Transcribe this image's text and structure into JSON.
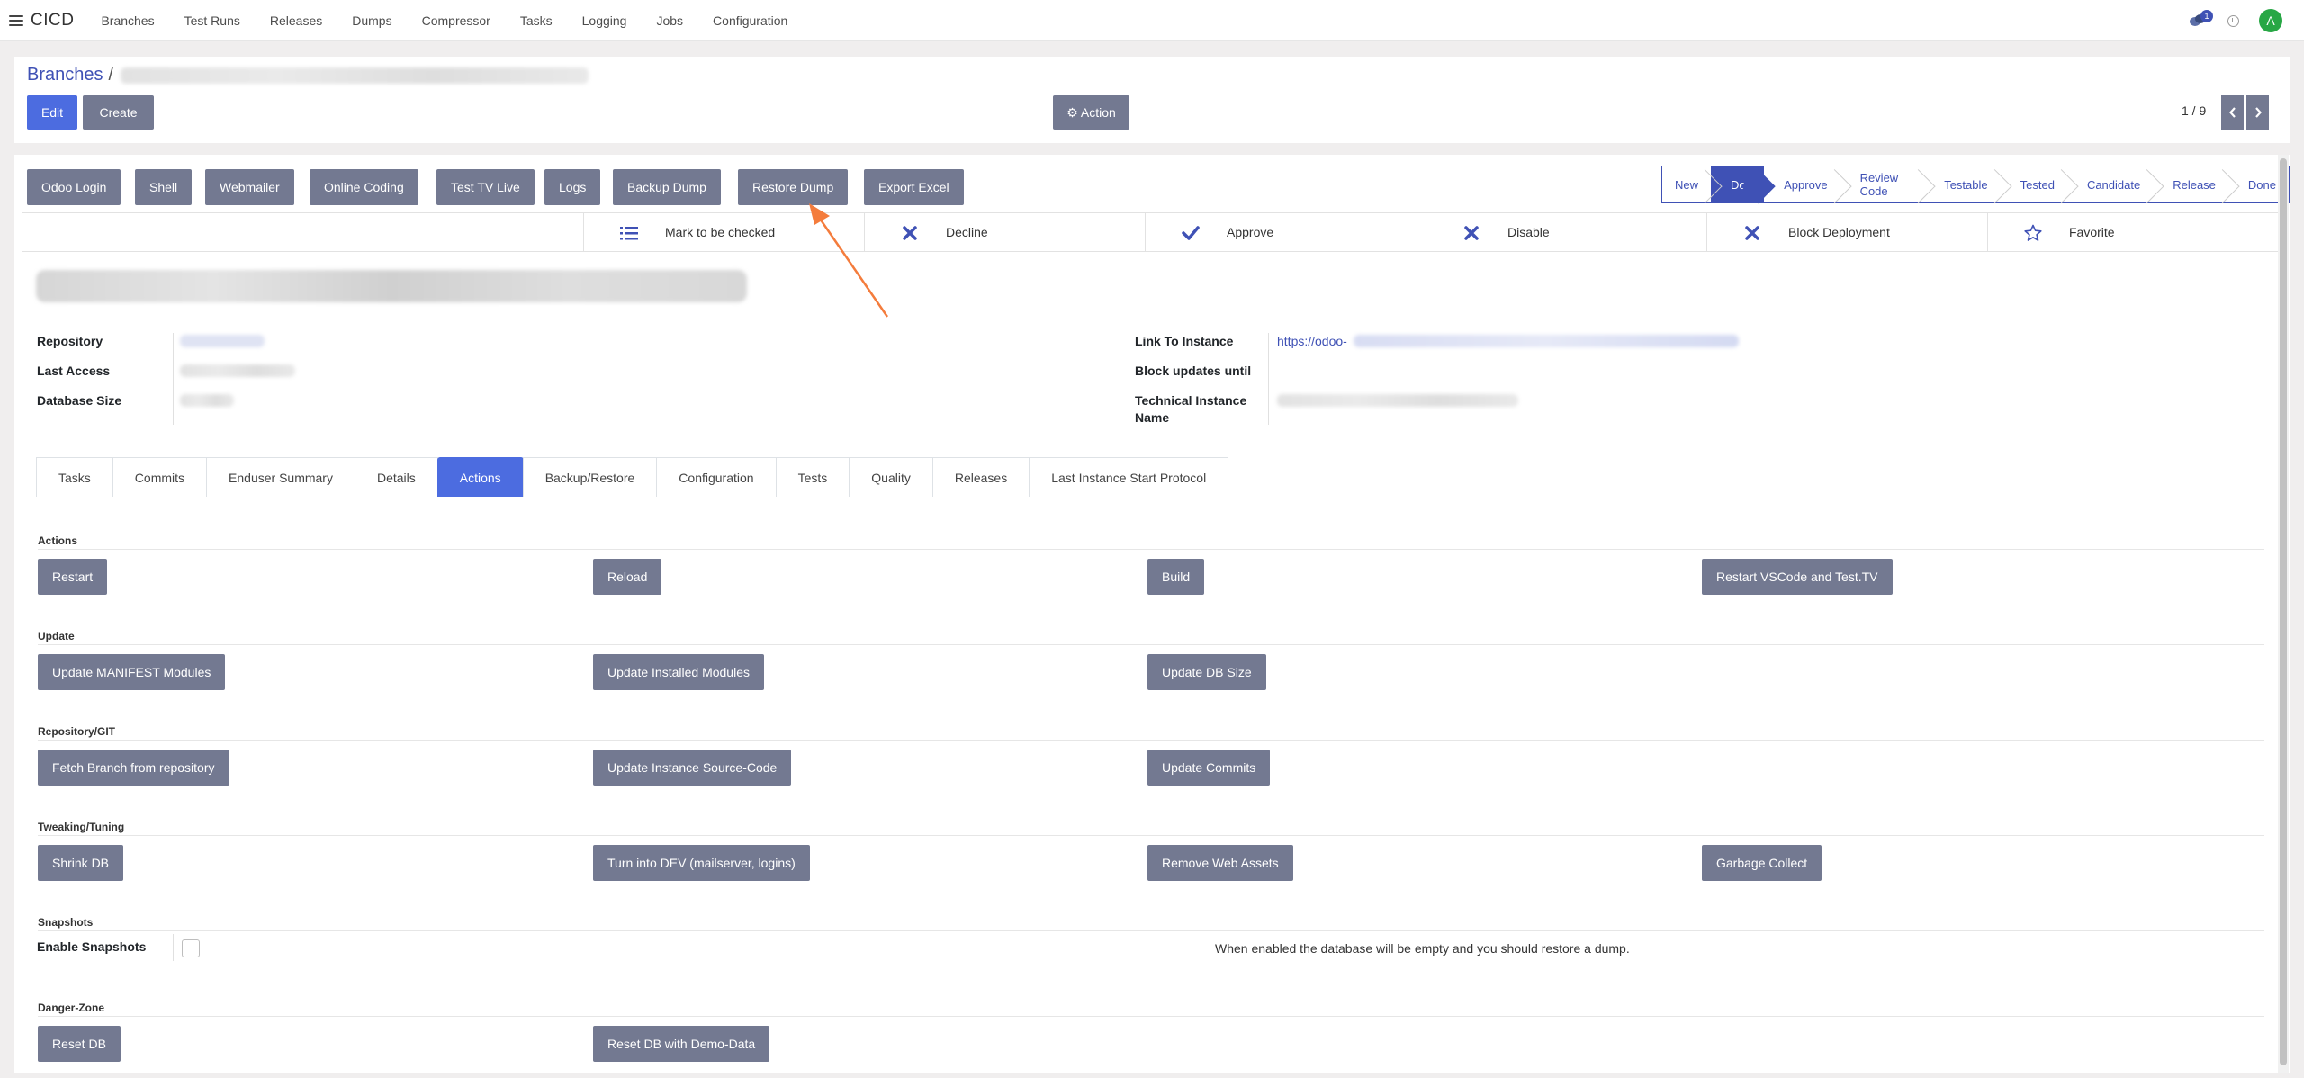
{
  "topnav": {
    "brand": "CICD",
    "menu": [
      "Branches",
      "Test Runs",
      "Releases",
      "Dumps",
      "Compressor",
      "Tasks",
      "Logging",
      "Jobs",
      "Configuration"
    ],
    "message_count": "1",
    "avatar_letter": "A"
  },
  "control_panel": {
    "breadcrumb_root": "Branches",
    "breadcrumb_sep": "/",
    "edit_label": "Edit",
    "create_label": "Create",
    "action_label": "⚙ Action",
    "pager": "1 / 9"
  },
  "header_buttons": [
    "Odoo Login",
    "Shell",
    "Webmailer",
    "Online Coding",
    "Test TV Live",
    "Logs",
    "Backup Dump",
    "Restore Dump",
    "Export Excel"
  ],
  "statusbar": {
    "stages": [
      "New",
      "Dev",
      "Approve",
      "Review Code",
      "Testable",
      "Tested",
      "Candidate",
      "Release",
      "Done"
    ],
    "active": "Dev"
  },
  "smart_buttons": [
    {
      "label": "Mark to be checked",
      "icon": "list-icon"
    },
    {
      "label": "Decline",
      "icon": "x-icon"
    },
    {
      "label": "Approve",
      "icon": "check-icon"
    },
    {
      "label": "Disable",
      "icon": "x-icon"
    },
    {
      "label": "Block Deployment",
      "icon": "x-icon"
    },
    {
      "label": "Favorite",
      "icon": "star-icon"
    }
  ],
  "fields_left": {
    "repository": "Repository",
    "last_access": "Last Access",
    "database_size": "Database Size"
  },
  "fields_right": {
    "link_to_instance": "Link To Instance",
    "link_value": "https://odoo-",
    "block_updates_until": "Block updates until",
    "technical_instance_name_1": "Technical Instance",
    "technical_instance_name_2": "Name"
  },
  "tabs": [
    "Tasks",
    "Commits",
    "Enduser Summary",
    "Details",
    "Actions",
    "Backup/Restore",
    "Configuration",
    "Tests",
    "Quality",
    "Releases",
    "Last Instance Start Protocol"
  ],
  "active_tab": "Actions",
  "sections": {
    "actions": {
      "title": "Actions",
      "buttons": [
        "Restart",
        "Reload",
        "Build",
        "Restart VSCode and Test.TV"
      ]
    },
    "update": {
      "title": "Update",
      "buttons": [
        "Update MANIFEST Modules",
        "Update Installed Modules",
        "Update DB Size"
      ]
    },
    "repo": {
      "title": "Repository/GIT",
      "buttons": [
        "Fetch Branch from repository",
        "Update Instance Source-Code",
        "Update Commits"
      ]
    },
    "tweaking": {
      "title": "Tweaking/Tuning",
      "buttons": [
        "Shrink DB",
        "Turn into DEV (mailserver, logins)",
        "Remove Web Assets",
        "Garbage Collect"
      ]
    },
    "snapshots": {
      "title": "Snapshots",
      "field_label": "Enable Snapshots",
      "note": "When enabled the database will be empty and you should restore a dump."
    },
    "danger": {
      "title": "Danger-Zone",
      "buttons": [
        "Reset DB",
        "Reset DB with Demo-Data"
      ]
    }
  },
  "colors": {
    "primary": "#4c6ce0",
    "secondary": "#737991",
    "accent": "#3f51b5",
    "annotation_arrow": "#f47c3c"
  }
}
